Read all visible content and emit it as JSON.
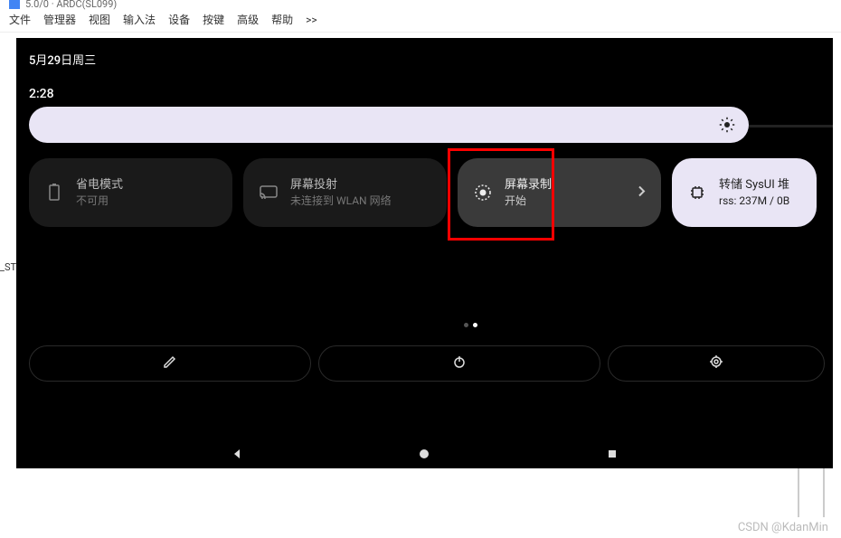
{
  "window": {
    "title_partial": "5.0/0 · ARDC(SL099)"
  },
  "menu": {
    "items": [
      "文件",
      "管理器",
      "视图",
      "输入法",
      "设备",
      "按键",
      "高级",
      "帮助",
      ">>"
    ]
  },
  "date": "5月29日周三",
  "time": "2:28",
  "tiles": [
    {
      "title": "省电模式",
      "sub": "不可用"
    },
    {
      "title": "屏幕投射",
      "sub": "未连接到 WLAN 网络"
    },
    {
      "title": "屏幕录制",
      "sub": "开始"
    },
    {
      "title": "转储 SysUI 堆",
      "sub": "rss: 237M / 0B"
    }
  ],
  "side_label": "_ST",
  "watermark": "CSDN @KdanMin"
}
